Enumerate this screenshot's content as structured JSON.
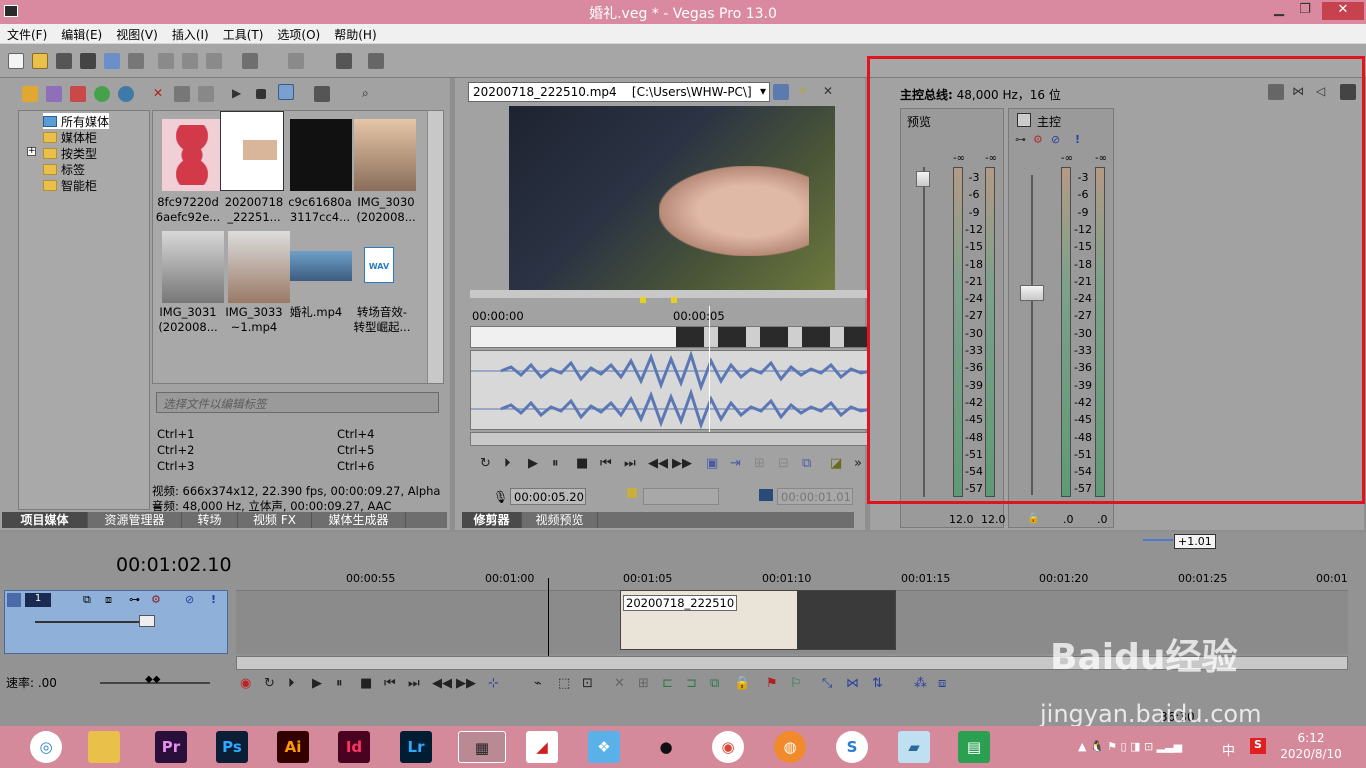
{
  "window": {
    "title": "婚礼.veg * - Vegas Pro 13.0",
    "min_icon": "minimize-icon",
    "restore_icon": "restore-icon",
    "close_icon": "close-icon"
  },
  "menu": [
    "文件(F)",
    "编辑(E)",
    "视图(V)",
    "插入(I)",
    "工具(T)",
    "选项(O)",
    "帮助(H)"
  ],
  "explorer": {
    "tree": [
      "所有媒体",
      "媒体柜",
      "按类型",
      "标签",
      "智能柜"
    ],
    "tree_expander": "+",
    "thumbs": [
      {
        "line1": "8fc97220d",
        "line2": "6aefc92e..."
      },
      {
        "line1": "20200718",
        "line2": "_22251..."
      },
      {
        "line1": "c9c61680a",
        "line2": "3117cc4..."
      },
      {
        "line1": "IMG_3030",
        "line2": "(202008..."
      },
      {
        "line1": "IMG_3031",
        "line2": "(202008..."
      },
      {
        "line1": "IMG_3033",
        "line2": "~1.mp4"
      },
      {
        "line1": "婚礼.mp4",
        "line2": ""
      },
      {
        "line1": "转场音效-",
        "line2": "转型崛起..."
      }
    ],
    "tag_placeholder": "选择文件以编辑标签",
    "shortcuts": [
      "Ctrl+1",
      "Ctrl+4",
      "Ctrl+2",
      "Ctrl+5",
      "Ctrl+3",
      "Ctrl+6"
    ],
    "video_info": "视频: 666x374x12, 22.390 fps, 00:00:09.27, Alpha =",
    "audio_info": "音频: 48,000 Hz, 立体声, 00:00:09.27, AAC",
    "tabs": [
      "项目媒体",
      "资源管理器",
      "转场",
      "视频 FX",
      "媒体生成器"
    ]
  },
  "trimmer": {
    "file": "20200718_222510.mp4",
    "path": "[C:\\Users\\WHW-PC\\]",
    "time_start": "00:00:00",
    "time_mid": "00:00:05",
    "current_time": "00:00:05.20",
    "length": "00:00:01.01",
    "tabs": [
      "修剪器",
      "视频预览"
    ]
  },
  "mixer": {
    "header_label": "主控总线:",
    "header_info": "48,000 Hz，16 位",
    "preview_label": "预览",
    "master_label": "主控",
    "minus_inf": "-∞",
    "scale": [
      "3",
      "6",
      "9",
      "12",
      "15",
      "18",
      "21",
      "24",
      "27",
      "30",
      "33",
      "36",
      "39",
      "42",
      "45",
      "48",
      "51",
      "54",
      "57"
    ],
    "preview_levels": [
      "12.0",
      "12.0"
    ],
    "master_levels": [
      ".0",
      ".0"
    ]
  },
  "timeline": {
    "time": "00:01:02.10",
    "rate_label": "速率: .00",
    "badge": "+1.01",
    "track_number": "1",
    "ruler": [
      "00:00:55",
      "00:01:00",
      "00:01:05",
      "00:01:10",
      "00:01:15",
      "00:01:20",
      "00:01:25",
      "00:01"
    ],
    "clip_name": "20200718_222510",
    "bottom_time": "36:30"
  },
  "watermark": {
    "text": "jingyan.baidu.com",
    "logo": "Baidu经验"
  },
  "taskbar": {
    "apps": [
      "Pr",
      "Ps",
      "Ai",
      "Id",
      "Lr"
    ],
    "time": "6:12",
    "date": "2020/8/10",
    "ime": "中"
  },
  "colors": {
    "title_bg": "#d98aa0",
    "panel": "#a2a2a2",
    "highlight": "#e0141e",
    "wave": "#5b78b5",
    "taskbar": "#d58a9c"
  }
}
